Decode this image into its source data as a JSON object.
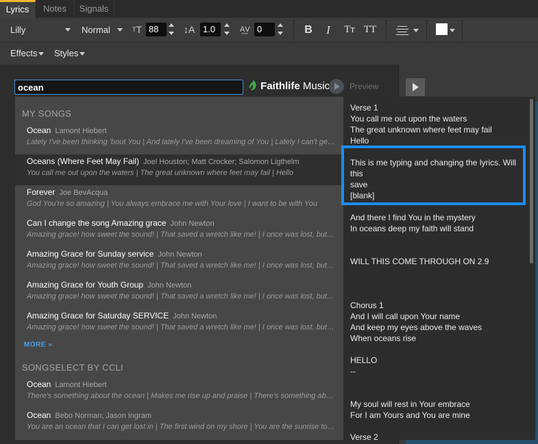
{
  "tabs": [
    "Lyrics",
    "Notes",
    "Signals"
  ],
  "toolbar": {
    "font": "Lilly",
    "weight": "Normal",
    "font_size": "88",
    "line_spacing": "1.0",
    "char_spacing": "0",
    "size_icon_label": "T",
    "bold": "B",
    "italic": "I",
    "case_lower": "Tт",
    "case_upper": "TT"
  },
  "toolbar2": {
    "effects": "Effects",
    "styles": "Styles"
  },
  "search": {
    "value": "ocean"
  },
  "brand": {
    "name_bold": "Faithlife",
    "name_light": " Music"
  },
  "preview_label": "Preview",
  "dropdown": {
    "my_songs_header": "MY SONGS",
    "songselect_header": "SONGSELECT BY CCLI",
    "more_label": "MORE »",
    "my_songs": [
      {
        "title": "Ocean",
        "author": "Lamont Hiebert",
        "lyrics": "Lately I've been thinking 'bout You | And lately I've been dreaming of You | Lately I can't get You out of my mind"
      },
      {
        "title": "Oceans (Where Feet May Fail)",
        "author": "Joel Houston; Matt Crocker; Salomon Ligthelm",
        "lyrics": "You call me out upon the waters | The great unknown where feet may fail | Hello"
      },
      {
        "title": "Forever",
        "author": "Joe BevAcqua",
        "lyrics": "God You're so amazing | You always embrace me with Your love | I want to be with You"
      },
      {
        "title": "Can I change the song Amazing grace",
        "author": "John Newton",
        "lyrics": "Amazing grace! how sweet the sound! | That saved a wretch like me! | I once was lost, but now am found"
      },
      {
        "title": "Amazing Grace for Sunday service",
        "author": "John Newton",
        "lyrics": "Amazing grace! how sweet the sound! | That saved a wretch like me! | I once was lost, but now am found"
      },
      {
        "title": "Amazing Grace for Youth Group",
        "author": "John Newton",
        "lyrics": "Amazing grace! how sweet the sound! | That saved a wretch like me! | I once was lost, but now am found"
      },
      {
        "title": "Amazing Grace for Saturday SERVICE",
        "author": "John Newton",
        "lyrics": "Amazing grace! how sweet the sound! | That saved a wretch like me! | I once was lost, but now am found"
      }
    ],
    "songselect": [
      {
        "title": "Ocean",
        "author": "Lamont Hiebert",
        "lyrics": "There's something about the ocean | Makes me rise up and praise | There's something about the sea"
      },
      {
        "title": "Ocean",
        "author": "Bebo Norman; Jason Ingram",
        "lyrics": "You are an ocean that I can get lost in | The first wind on my shore | You are the sunrise to open my eyes"
      }
    ]
  },
  "lyrics_panel": [
    "Verse 1",
    "You call me out upon the waters",
    "The great unknown where feet may fail",
    "Hello",
    "This is me typing and changing the lyrics. Will",
    "this",
    "save",
    "[blank]",
    "And there I find You in the mystery",
    "In oceans deep my faith will stand",
    "WILL THIS COME THROUGH ON 2.9",
    "Chorus 1",
    "And I will call upon Your name",
    "And keep my eyes above the waves",
    "When oceans rise",
    "HELLO",
    "--",
    "My soul will rest in Your embrace",
    "For I am Yours and You are mine",
    "Verse 2"
  ]
}
